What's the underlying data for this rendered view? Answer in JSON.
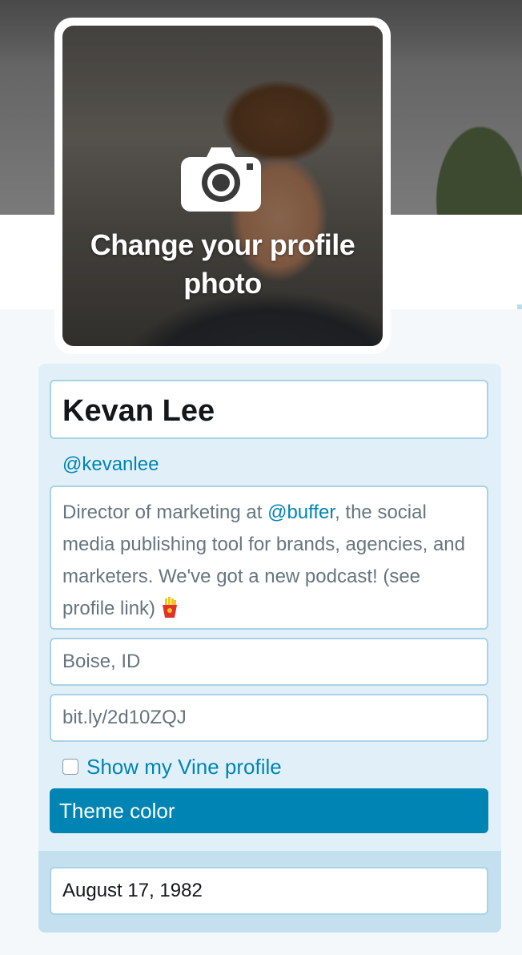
{
  "profile_photo": {
    "change_label": "Change your profile photo"
  },
  "profile": {
    "name": "Kevan Lee",
    "handle": "@kevanlee",
    "bio_before": "Director of marketing at ",
    "bio_mention": "@buffer",
    "bio_after": ", the social media publishing tool for brands, agencies, and marketers. We've got a new podcast! (see profile link) ",
    "bio_emoji_icon": "french-fries-icon",
    "location": "Boise, ID",
    "website": "bit.ly/2d10ZQJ",
    "show_vine_label": "Show my Vine profile",
    "show_vine_checked": false,
    "theme_color_label": "Theme color",
    "birthday": "August 17, 1982"
  },
  "colors": {
    "accent": "#0084b4",
    "card_background": "#e1f0f8",
    "field_border": "#a8d3e6"
  }
}
